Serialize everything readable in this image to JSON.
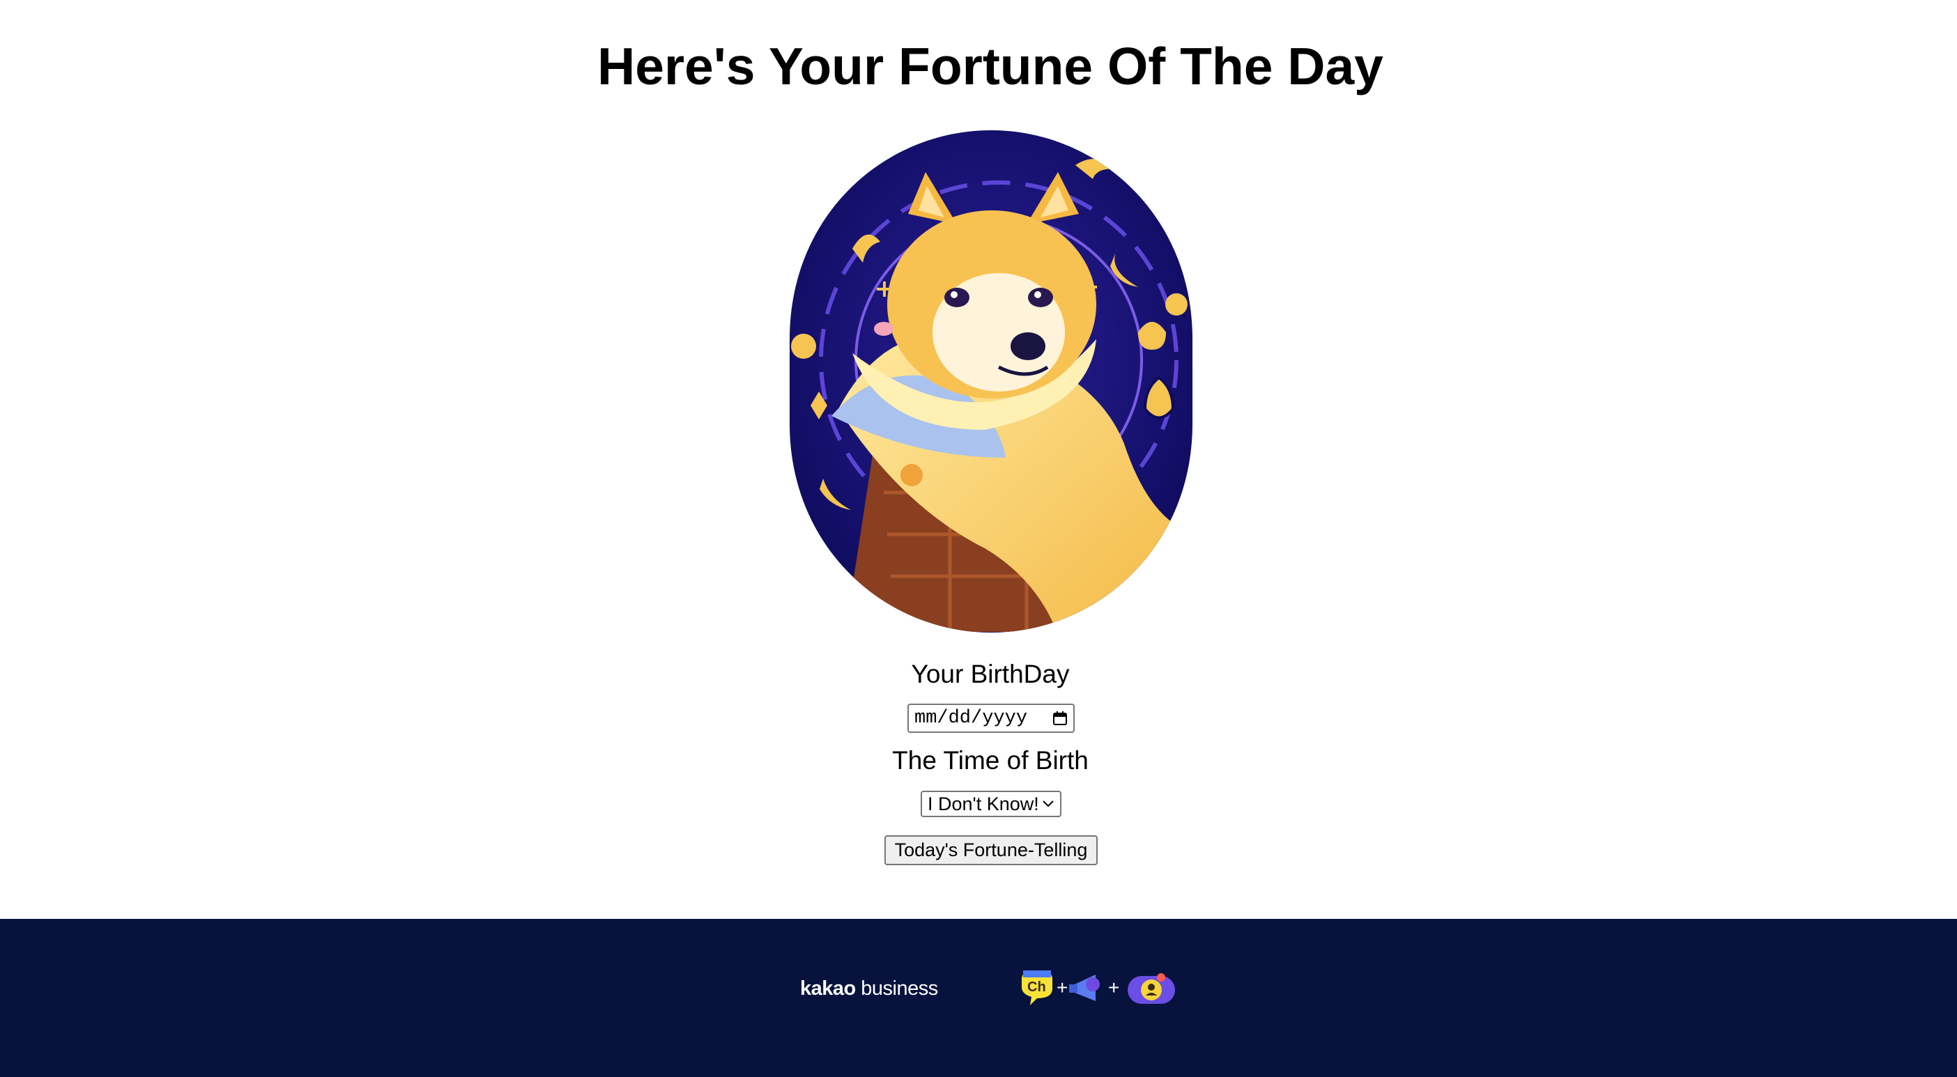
{
  "page": {
    "title": "Here's Your Fortune Of The Day"
  },
  "form": {
    "birthday_label": "Your BirthDay",
    "date_placeholder": "mm/dd/yyyy",
    "time_label": "The Time of Birth",
    "time_selected": "I Don't Know!",
    "submit_label": "Today's Fortune-Telling"
  },
  "footer": {
    "brand_bold": "kakao",
    "brand_light": "business",
    "channel_icon_text": "Ch",
    "plus_1": "+",
    "plus_2": "+"
  },
  "colors": {
    "footer_bg": "#07133d",
    "portrait_bg": "#14106a",
    "accent_gold": "#f5c451"
  },
  "icons": [
    "calendar-icon",
    "chevron-down-icon",
    "kakao-channel-icon",
    "megaphone-icon",
    "profile-icon"
  ]
}
